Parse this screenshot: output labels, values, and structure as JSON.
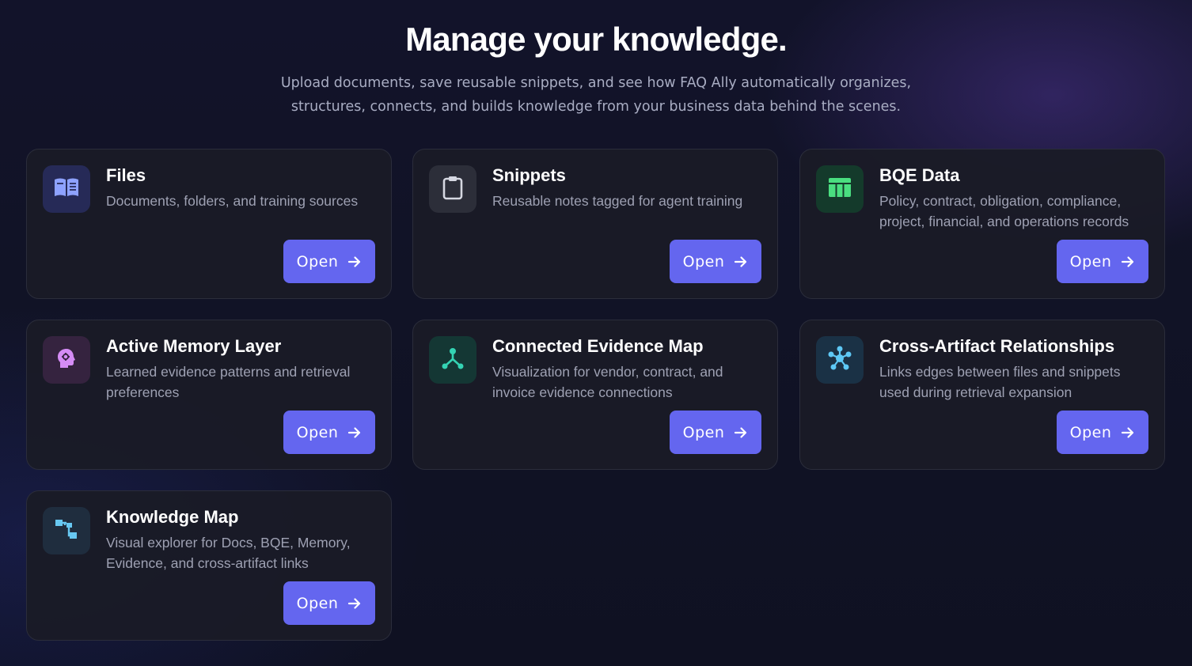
{
  "hero": {
    "title": "Manage your knowledge.",
    "subtitle": "Upload documents, save reusable snippets, and see how FAQ Ally automatically organizes, structures, connects, and builds knowledge from your business data behind the scenes."
  },
  "colors": {
    "button": "#6466ef",
    "card_bg": "#1a1b26",
    "card_border": "#2b2d3b"
  },
  "cards": [
    {
      "title": "Files",
      "description": "Documents, folders, and training sources",
      "button_label": "Open",
      "icon": "book-open-icon",
      "icon_color": "#8ea2ff",
      "icon_bg": "#262a57"
    },
    {
      "title": "Snippets",
      "description": "Reusable notes tagged for agent training",
      "button_label": "Open",
      "icon": "clipboard-icon",
      "icon_color": "#d6d8e2",
      "icon_bg": "#2c2e39"
    },
    {
      "title": "BQE Data",
      "description": "Policy, contract, obligation, compliance, project, financial, and operations records",
      "button_label": "Open",
      "icon": "table-icon",
      "icon_color": "#4ade80",
      "icon_bg": "#143a2b"
    },
    {
      "title": "Active Memory Layer",
      "description": "Learned evidence patterns and retrieval preferences",
      "button_label": "Open",
      "icon": "brain-head-icon",
      "icon_color": "#d58cf5",
      "icon_bg": "#35233f"
    },
    {
      "title": "Connected Evidence Map",
      "description": "Visualization for vendor, contract, and invoice evidence connections",
      "button_label": "Open",
      "icon": "network-fork-icon",
      "icon_color": "#34d3b3",
      "icon_bg": "#143734"
    },
    {
      "title": "Cross-Artifact Relationships",
      "description": "Links edges between files and snippets used during retrieval expansion",
      "button_label": "Open",
      "icon": "hub-nodes-icon",
      "icon_color": "#5ec8f5",
      "icon_bg": "#1a3145"
    },
    {
      "title": "Knowledge Map",
      "description": "Visual explorer for Docs, BQE, Memory, Evidence, and cross-artifact links",
      "button_label": "Open",
      "icon": "tree-map-icon",
      "icon_color": "#67c8f2",
      "icon_bg": "#1f2d3e"
    }
  ]
}
